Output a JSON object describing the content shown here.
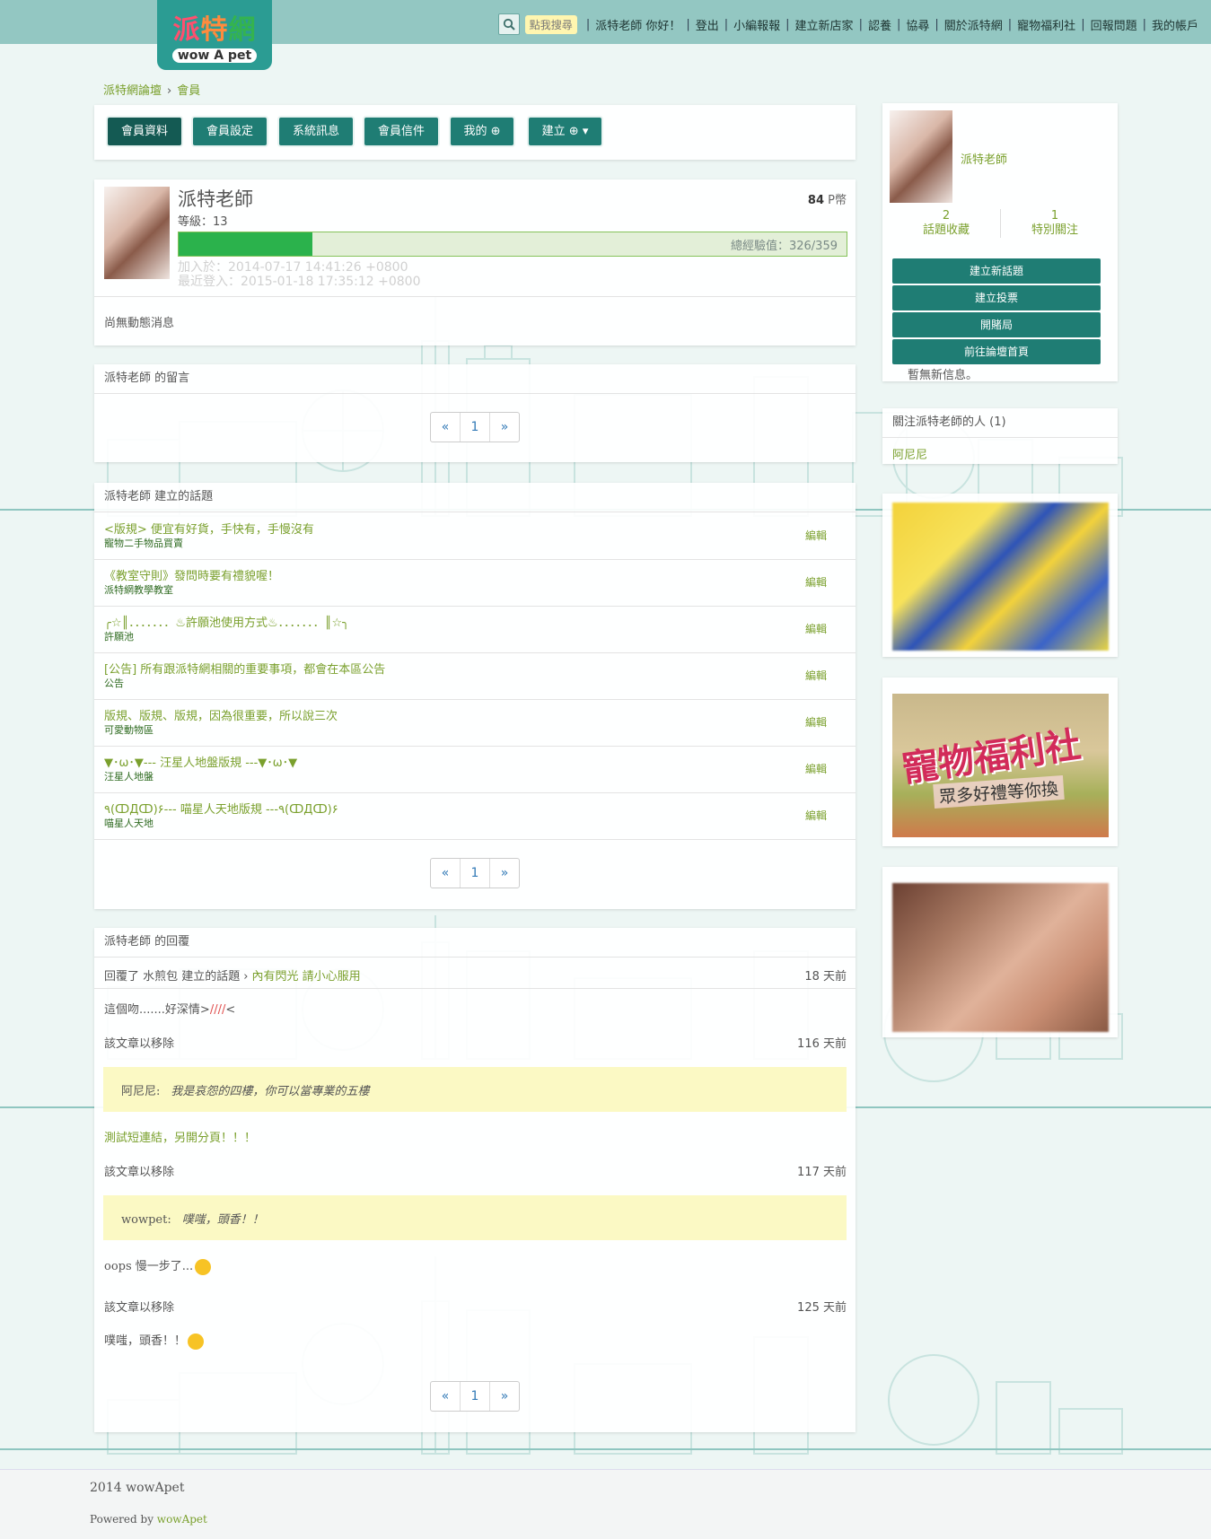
{
  "header": {
    "logo_ch": [
      "派",
      "特",
      "網"
    ],
    "logo_en": "wow A pet",
    "search_hint": "點我搜尋",
    "nav": [
      "派特老師 你好！",
      "登出",
      "小編報報",
      "建立新店家",
      "認養",
      "協尋",
      "關於派特網",
      "寵物福利社",
      "回報問題",
      "我的帳戶"
    ]
  },
  "breadcrumb": {
    "home": "派特網論壇",
    "current": "會員"
  },
  "tabs": [
    "會員資料",
    "會員設定",
    "系統訊息",
    "會員信件",
    "我的",
    "建立"
  ],
  "profile": {
    "name": "派特老師",
    "level": "等級：13",
    "points": "84",
    "points_unit": "P幣",
    "exp_label": "總經驗值：326/359",
    "exp_fraction": 0.2,
    "joined": "加入於：2014-07-17 14:41:26 +0800",
    "last_login": "最近登入：2015-01-18 17:35:12 +0800",
    "no_activity": "尚無動態消息"
  },
  "guestbook": {
    "title": "派特老師 的留言",
    "pager": [
      "«",
      "1",
      "»"
    ]
  },
  "topics": {
    "title": "派特老師 建立的話題",
    "edit_label": "編輯",
    "items": [
      {
        "title": "<版規> 便宜有好貨，手快有，手慢沒有",
        "forum": "寵物二手物品買賣"
      },
      {
        "title": "《教室守則》發問時要有禮貌喔！",
        "forum": "派特網教學教室"
      },
      {
        "title": "╭☆║．．．．．．．♨許願池使用方式♨．．．．．．．║☆╮",
        "forum": "許願池"
      },
      {
        "title": "[公告] 所有跟派特網相關的重要事項，都會在本區公告",
        "forum": "公告"
      },
      {
        "title": "版規、版規、版規，因為很重要，所以說三次",
        "forum": "可愛動物區"
      },
      {
        "title": "▼･ω･▼---  汪星人地盤版規 ---▼･ω･▼",
        "forum": "汪星人地盤"
      },
      {
        "title": "٩(ↀДↀ)۶---  喵星人天地版規 ---٩(ↀДↀ)۶",
        "forum": "喵星人天地"
      }
    ],
    "pager": [
      "«",
      "1",
      "»"
    ]
  },
  "replies": {
    "title": "派特老師 的回覆",
    "first": {
      "prefix": "回覆了 水煎包 建立的話題",
      "link": "內有閃光 請小心服用",
      "time": "18 天前",
      "body": "這個吻.......好深情>",
      "body_red": "////",
      "body_tail": "<"
    },
    "removed_label": "該文章以移除",
    "items": [
      {
        "time": "116 天前",
        "quote_user": "阿尼尼:",
        "quote_text": "我是哀怨的四樓，你可以當專業的五樓",
        "body": "測試短連結，另開分頁！！！"
      },
      {
        "time": "117 天前",
        "quote_user": "wowpet:",
        "quote_text": "噗嗤，頭香！！",
        "body": "oops 慢一步了..."
      },
      {
        "time": "125 天前",
        "body": "噗嗤，頭香！！"
      }
    ],
    "pager": [
      "«",
      "1",
      "»"
    ]
  },
  "sidebar": {
    "name": "派特老師",
    "stats": [
      {
        "num": "2",
        "label": "話題收藏"
      },
      {
        "num": "1",
        "label": "特別關注"
      }
    ],
    "buttons": [
      "建立新話題",
      "建立投票",
      "開賭局",
      "前往論壇首頁"
    ],
    "no_message": "暫無新信息。",
    "followers_title": "關注派特老師的人 (1)",
    "follower": "阿尼尼",
    "ad2_line1": "寵物福利社",
    "ad2_line2": "眾多好禮等你換"
  },
  "footer": {
    "copyright": "2014 wowApet",
    "powered_prefix": "Powered by ",
    "powered_link": "wowApet"
  }
}
